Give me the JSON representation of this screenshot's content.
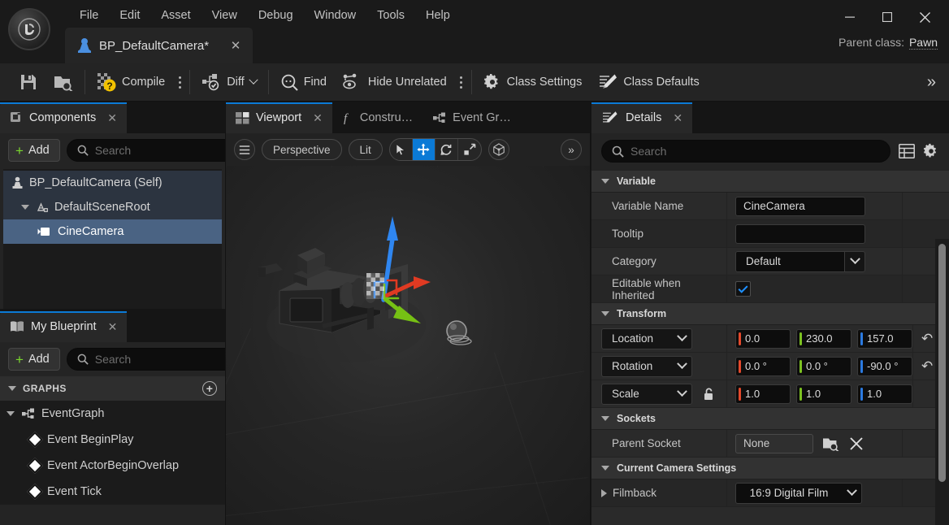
{
  "window": {
    "logo_text": "UE",
    "minimize_label": "─",
    "maximize_label": "□",
    "close_label": "✕",
    "parent_class_label": "Parent class:",
    "parent_class_value": "Pawn"
  },
  "menubar": {
    "items": [
      "File",
      "Edit",
      "Asset",
      "View",
      "Debug",
      "Window",
      "Tools",
      "Help"
    ]
  },
  "document_tab": {
    "title": "BP_DefaultCamera*",
    "close_label": "✕",
    "icon": "pawn-icon"
  },
  "toolbar": {
    "save_label": "",
    "browse_label": "",
    "compile_label": "Compile",
    "diff_label": "Diff",
    "find_label": "Find",
    "hide_unrelated_label": "Hide Unrelated",
    "class_settings_label": "Class Settings",
    "class_defaults_label": "Class Defaults",
    "overflow_label": "»"
  },
  "components": {
    "tab_label": "Components",
    "tab_close": "✕",
    "add_label": "Add",
    "search_placeholder": "Search",
    "search_value": "",
    "tree": [
      {
        "label": "BP_DefaultCamera (Self)",
        "level": 0,
        "icon": "pawn-icon",
        "selected": false,
        "expander": false
      },
      {
        "label": "DefaultSceneRoot",
        "level": 1,
        "icon": "scene-root-icon",
        "selected": false,
        "expander": true
      },
      {
        "label": "CineCamera",
        "level": 2,
        "icon": "camera-icon",
        "selected": true,
        "expander": false
      }
    ]
  },
  "my_blueprint": {
    "tab_label": "My Blueprint",
    "tab_close": "✕",
    "add_label": "Add",
    "search_placeholder": "Search",
    "search_value": "",
    "settings_icon": "gear-icon",
    "section_label": "GRAPHS",
    "section_add": "+",
    "graph_label": "EventGraph",
    "events": [
      "Event BeginPlay",
      "Event ActorBeginOverlap",
      "Event Tick"
    ]
  },
  "viewport": {
    "tabs": [
      {
        "label": "Viewport",
        "active": true,
        "closable": true,
        "icon": "viewport-icon"
      },
      {
        "label": "Constru…",
        "active": false,
        "closable": false,
        "icon": "function-icon"
      },
      {
        "label": "Event Gr…",
        "active": false,
        "closable": false,
        "icon": "graph-icon"
      }
    ],
    "tab_close": "✕",
    "menu_icon": "hamburger-icon",
    "camera_mode": "Perspective",
    "view_mode": "Lit",
    "gizmos": [
      {
        "name": "select-icon",
        "selected": false
      },
      {
        "name": "move-icon",
        "selected": true
      },
      {
        "name": "rotate-icon",
        "selected": false
      },
      {
        "name": "scale-icon",
        "selected": false
      }
    ],
    "coordinate_icon": "world-axis-icon",
    "overflow_label": "»"
  },
  "details": {
    "tab_label": "Details",
    "tab_close": "✕",
    "search_placeholder": "Search",
    "search_value": "",
    "column_icon": "columns-icon",
    "settings_icon": "gear-icon",
    "sections": [
      {
        "title": "Variable",
        "expanded": true,
        "rows": [
          {
            "label": "Variable Name",
            "type": "text",
            "value": "CineCamera"
          },
          {
            "label": "Tooltip",
            "type": "text",
            "value": ""
          },
          {
            "label": "Category",
            "type": "combo",
            "value": "Default"
          },
          {
            "label": "Editable when Inherited",
            "type": "checkbox",
            "value": true
          }
        ]
      },
      {
        "title": "Transform",
        "expanded": true,
        "rows": [
          {
            "label": "Location",
            "type": "vector",
            "values": [
              "0.0",
              "230.0",
              "157.0"
            ],
            "reset": true,
            "lock": false
          },
          {
            "label": "Rotation",
            "type": "vector",
            "values": [
              "0.0 °",
              "0.0 °",
              "-90.0 °"
            ],
            "reset": true,
            "lock": false
          },
          {
            "label": "Scale",
            "type": "vector",
            "values": [
              "1.0",
              "1.0",
              "1.0"
            ],
            "reset": false,
            "lock": true
          }
        ]
      },
      {
        "title": "Sockets",
        "expanded": true,
        "rows": [
          {
            "label": "Parent Socket",
            "type": "socket",
            "value": "None",
            "browse_icon": "browse-icon",
            "clear_icon": "clear-icon"
          }
        ]
      },
      {
        "title": "Current Camera Settings",
        "expanded": true,
        "rows": [
          {
            "label": "Filmback",
            "type": "combo_expand",
            "value": "16:9 Digital Film"
          }
        ]
      }
    ]
  },
  "colors": {
    "accent_blue": "#0b7ad6",
    "selection_blue": "#4a6383",
    "tree_row_bg": "#2c3440",
    "axis_x": "#e4492c",
    "axis_y": "#7cc221",
    "axis_z": "#2b7ae0",
    "add_plus_green": "#7ad82e",
    "compile_badge": "#f2c200"
  }
}
